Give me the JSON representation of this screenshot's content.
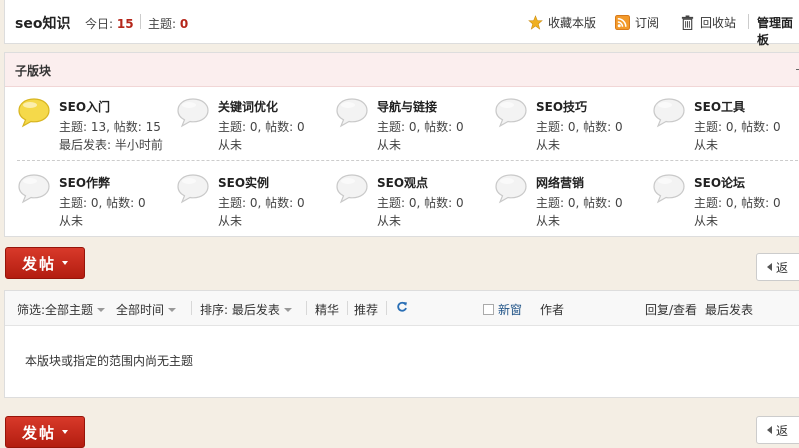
{
  "header": {
    "forum_name": "seo知识",
    "today_label": "今日:",
    "today_count": "15",
    "topics_label": "主题:",
    "topics_count": "0",
    "links": {
      "favorite": "收藏本版",
      "subscribe": "订阅",
      "recycle": "回收站",
      "manage": "管理面板"
    }
  },
  "subforums": {
    "title": "子版块",
    "items": [
      {
        "name": "SEO入门",
        "stats": "主题: 13, 帖数: 15",
        "last": "最后发表: 半小时前",
        "active": true
      },
      {
        "name": "关键词优化",
        "stats": "主题: 0, 帖数: 0",
        "last": "从未",
        "active": false
      },
      {
        "name": "导航与链接",
        "stats": "主题: 0, 帖数: 0",
        "last": "从未",
        "active": false
      },
      {
        "name": "SEO技巧",
        "stats": "主题: 0, 帖数: 0",
        "last": "从未",
        "active": false
      },
      {
        "name": "SEO工具",
        "stats": "主题: 0, 帖数: 0",
        "last": "从未",
        "active": false
      },
      {
        "name": "SEO作弊",
        "stats": "主题: 0, 帖数: 0",
        "last": "从未",
        "active": false
      },
      {
        "name": "SEO实例",
        "stats": "主题: 0, 帖数: 0",
        "last": "从未",
        "active": false
      },
      {
        "name": "SEO观点",
        "stats": "主题: 0, 帖数: 0",
        "last": "从未",
        "active": false
      },
      {
        "name": "网络营销",
        "stats": "主题: 0, 帖数: 0",
        "last": "从未",
        "active": false
      },
      {
        "name": "SEO论坛",
        "stats": "主题: 0, 帖数: 0",
        "last": "从未",
        "active": false
      }
    ]
  },
  "actions": {
    "post_label": "发帖",
    "back_label": "返"
  },
  "threadlist": {
    "filter_label": "筛选:",
    "all_topics": "全部主题",
    "all_time": "全部时间",
    "sort_label": "排序:",
    "sort_value": "最后发表",
    "digest": "精华",
    "recommend": "推荐",
    "new_window": "新窗",
    "author_col": "作者",
    "replies_col": "回复/查看",
    "last_post_col": "最后发表",
    "empty_text": "本版块或指定的范围内尚无主题"
  },
  "colors": {
    "accent_red": "#b5261a",
    "button_red": "#c7291b",
    "link_blue": "#225588",
    "bubble_active": "#f5d94a"
  }
}
